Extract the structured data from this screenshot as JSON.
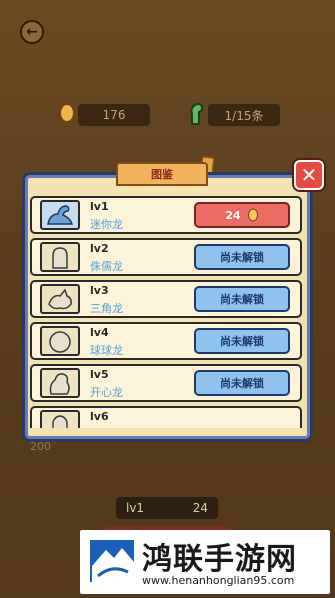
{
  "header": {
    "coins": "176",
    "dinos": "1/15条"
  },
  "panel": {
    "title": "图鉴"
  },
  "rows": [
    {
      "level": "lv1",
      "name": "迷你龙",
      "action": "24",
      "unlocked": true
    },
    {
      "level": "lv2",
      "name": "侏儒龙",
      "action": "尚未解锁",
      "unlocked": false
    },
    {
      "level": "lv3",
      "name": "三角龙",
      "action": "尚未解锁",
      "unlocked": false
    },
    {
      "level": "lv4",
      "name": "球球龙",
      "action": "尚未解锁",
      "unlocked": false
    },
    {
      "level": "lv5",
      "name": "开心龙",
      "action": "尚未解锁",
      "unlocked": false
    },
    {
      "level": "lv6",
      "name": "",
      "action": "",
      "unlocked": false
    }
  ],
  "behind": {
    "side_value": "200"
  },
  "bottom": {
    "level": "lv1",
    "price": "24"
  },
  "watermark": {
    "title": "鸿联手游网",
    "url": "www.henanhonglian95.com"
  },
  "colors": {
    "accent_red": "#e64a43",
    "button_blue": "#8ec3ef",
    "panel_bg": "#f2e3b0"
  }
}
